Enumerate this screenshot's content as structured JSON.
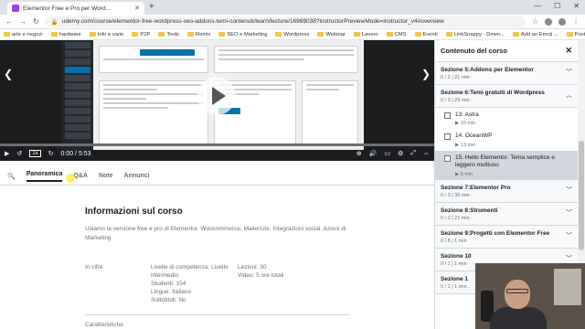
{
  "browser": {
    "tab_title": "Elementor Free e Pro per Word...",
    "url": "udemy.com/course/elementor-free-wordpress-seo-addons-temi-contenuti/learn/lecture/16969038?instructorPreviewMode=instructor_v4#overview",
    "bookmarks": [
      "arte e negozi",
      "hardware",
      "Info e varie",
      "P2P",
      "Tools",
      "Remix",
      "SEO e Marketing",
      "Wordpress",
      "Webinar",
      "Lavoro",
      "CMS",
      "Eventi",
      "LinkSnappy - Down...",
      "Add an Emoji ...",
      "PostPickr - Pianora..."
    ]
  },
  "player": {
    "time": "0:00 / 5:53",
    "speed": "1x",
    "progress": 0.0
  },
  "tabs": [
    "Panoramica",
    "Q&A",
    "Note",
    "Annunci"
  ],
  "course": {
    "heading": "Informazioni sul corso",
    "description": "Usiamo la versione free e pro di Elementor. Woocommerce. MailerLite. Integrazioni social. Azioni di Marketing",
    "figures_label": "In cifre",
    "level": "Livello di competenza: Livello intermedio",
    "students": "Studenti: 154",
    "languages": "Lingue: Italiano",
    "subtitles": "Sottotitoli: No",
    "lectures": "Lezioni: 30",
    "video": "Video: 5 ore totali",
    "footer_partial": "Caratteristiche"
  },
  "sidebar": {
    "title": "Contenuto del corso",
    "sections": [
      {
        "title": "Sezione 5:Addons per Elementor",
        "meta": "0 / 2 | 21 min",
        "expanded": false
      },
      {
        "title": "Sezione 6:Temi gratuiti di Wordpress",
        "meta": "0 / 3 | 29 min",
        "expanded": true,
        "lessons": [
          {
            "title": "13. Astra",
            "duration": "10 min",
            "current": false
          },
          {
            "title": "14. OceanWP",
            "duration": "13 min",
            "current": false
          },
          {
            "title": "15. Hello Elementor. Tema semplice e leggero multiuso",
            "duration": "6 min",
            "current": true
          }
        ]
      },
      {
        "title": "Sezione 7:Elementor Pro",
        "meta": "0 / 3 | 36 min",
        "expanded": false
      },
      {
        "title": "Sezione 8:Strumenti",
        "meta": "0 / 2 | 21 min",
        "expanded": false
      },
      {
        "title": "Sezione 9:Progetti con Elementor Free",
        "meta": "0 / 8 | 1 min",
        "expanded": false
      },
      {
        "title": "Sezione 10",
        "meta": "0 / 1 | 1 min",
        "expanded": false
      },
      {
        "title": "Sezione 1",
        "meta": "0 / 1 | 1 min",
        "expanded": false
      }
    ]
  },
  "colors": {
    "accent": "#a435f0",
    "dark": "#1c1d1f",
    "muted": "#6a6f73"
  }
}
